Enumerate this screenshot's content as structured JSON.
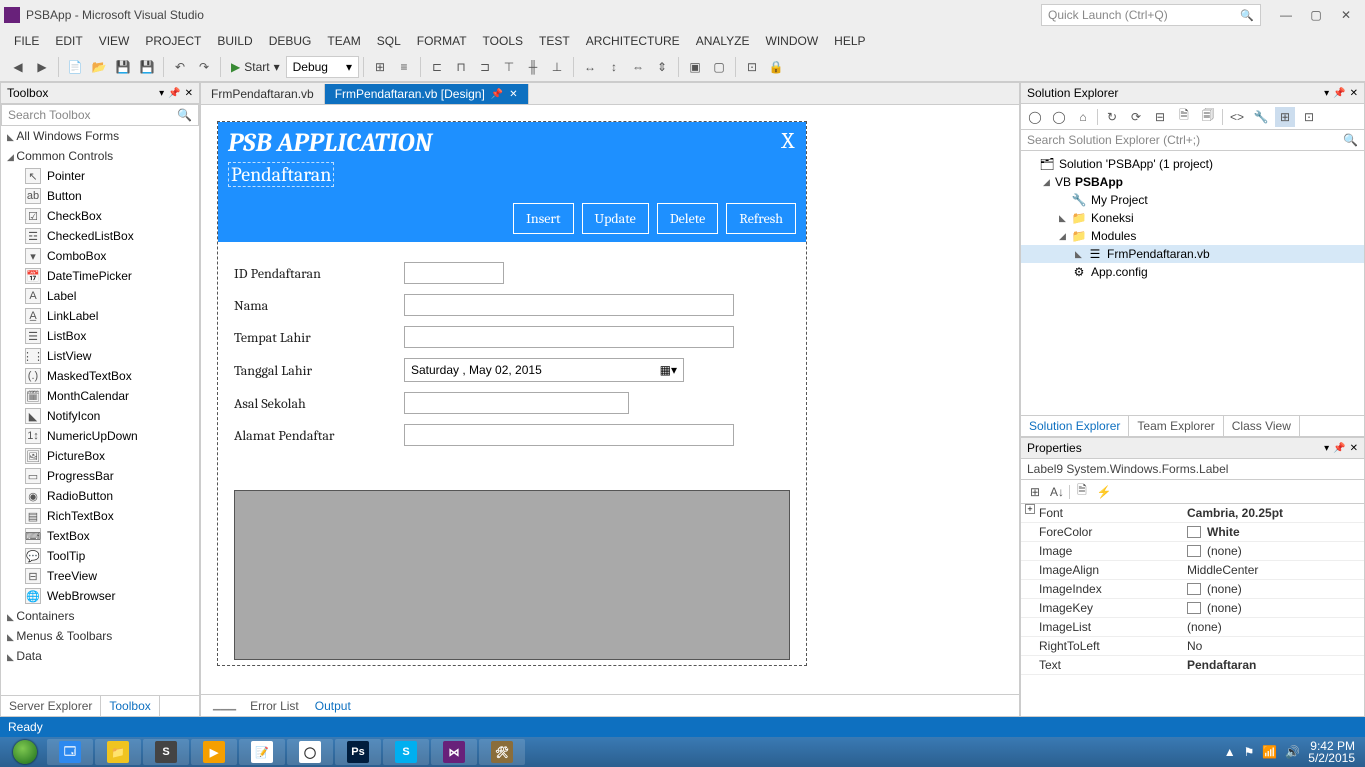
{
  "titlebar": {
    "title": "PSBApp - Microsoft Visual Studio",
    "quick_launch": "Quick Launch (Ctrl+Q)"
  },
  "menu": [
    "FILE",
    "EDIT",
    "VIEW",
    "PROJECT",
    "BUILD",
    "DEBUG",
    "TEAM",
    "SQL",
    "FORMAT",
    "TOOLS",
    "TEST",
    "ARCHITECTURE",
    "ANALYZE",
    "WINDOW",
    "HELP"
  ],
  "toolbar": {
    "start": "Start",
    "config": "Debug"
  },
  "toolbox": {
    "title": "Toolbox",
    "search": "Search Toolbox",
    "cats": [
      {
        "name": "All Windows Forms",
        "open": false
      },
      {
        "name": "Common Controls",
        "open": true,
        "items": [
          {
            "ico": "↖",
            "name": "Pointer"
          },
          {
            "ico": "ab",
            "name": "Button"
          },
          {
            "ico": "☑",
            "name": "CheckBox"
          },
          {
            "ico": "☲",
            "name": "CheckedListBox"
          },
          {
            "ico": "▾",
            "name": "ComboBox"
          },
          {
            "ico": "📅",
            "name": "DateTimePicker"
          },
          {
            "ico": "A",
            "name": "Label"
          },
          {
            "ico": "A̲",
            "name": "LinkLabel"
          },
          {
            "ico": "☰",
            "name": "ListBox"
          },
          {
            "ico": "⋮⋮",
            "name": "ListView"
          },
          {
            "ico": "(.)",
            "name": "MaskedTextBox"
          },
          {
            "ico": "🗓",
            "name": "MonthCalendar"
          },
          {
            "ico": "◣",
            "name": "NotifyIcon"
          },
          {
            "ico": "1↕",
            "name": "NumericUpDown"
          },
          {
            "ico": "🖼",
            "name": "PictureBox"
          },
          {
            "ico": "▭",
            "name": "ProgressBar"
          },
          {
            "ico": "◉",
            "name": "RadioButton"
          },
          {
            "ico": "▤",
            "name": "RichTextBox"
          },
          {
            "ico": "⌨",
            "name": "TextBox"
          },
          {
            "ico": "💬",
            "name": "ToolTip"
          },
          {
            "ico": "⊟",
            "name": "TreeView"
          },
          {
            "ico": "🌐",
            "name": "WebBrowser"
          }
        ]
      },
      {
        "name": "Containers",
        "open": false
      },
      {
        "name": "Menus & Toolbars",
        "open": false
      },
      {
        "name": "Data",
        "open": false
      }
    ],
    "bottom_tabs": [
      "Server Explorer",
      "Toolbox"
    ]
  },
  "editor": {
    "tabs": [
      {
        "label": "FrmPendaftaran.vb",
        "active": false
      },
      {
        "label": "FrmPendaftaran.vb [Design]",
        "active": true
      }
    ],
    "form": {
      "title": "PSB APPLICATION",
      "subtitle": "Pendaftaran",
      "close": "X",
      "buttons": [
        "Insert",
        "Update",
        "Delete",
        "Refresh"
      ],
      "fields": [
        {
          "label": "ID Pendaftaran",
          "w": "w1"
        },
        {
          "label": "Nama",
          "w": "w2"
        },
        {
          "label": "Tempat Lahir",
          "w": "w2"
        }
      ],
      "date_label": "Tanggal Lahir",
      "date_value": "Saturday ,      May      02, 2015",
      "fields2": [
        {
          "label": "Asal Sekolah",
          "w": "w3"
        },
        {
          "label": "Alamat Pendaftar",
          "w": "w2"
        }
      ]
    },
    "out_label": "Output",
    "out_tabs": [
      "Error List",
      "Output"
    ]
  },
  "solexp": {
    "title": "Solution Explorer",
    "search": "Search Solution Explorer (Ctrl+;)",
    "nodes": [
      {
        "d": 0,
        "arr": "",
        "ico": "🗂",
        "label": "Solution 'PSBApp' (1 project)"
      },
      {
        "d": 1,
        "arr": "◢",
        "ico": "VB",
        "label": "PSBApp",
        "bold": true
      },
      {
        "d": 2,
        "arr": "",
        "ico": "🔧",
        "label": "My Project"
      },
      {
        "d": 2,
        "arr": "◣",
        "ico": "📁",
        "label": "Koneksi"
      },
      {
        "d": 2,
        "arr": "◢",
        "ico": "📁",
        "label": "Modules"
      },
      {
        "d": 3,
        "arr": "◣",
        "ico": "☰",
        "label": "FrmPendaftaran.vb",
        "sel": true
      },
      {
        "d": 2,
        "arr": "",
        "ico": "⚙",
        "label": "App.config"
      }
    ],
    "bottom_tabs": [
      "Solution Explorer",
      "Team Explorer",
      "Class View"
    ]
  },
  "props": {
    "title": "Properties",
    "object": "Label9 System.Windows.Forms.Label",
    "rows": [
      {
        "k": "Font",
        "v": "Cambria, 20.25pt",
        "bold": true,
        "plus": true
      },
      {
        "k": "ForeColor",
        "v": "White",
        "bold": true,
        "sw": true
      },
      {
        "k": "Image",
        "v": "(none)",
        "sw": true
      },
      {
        "k": "ImageAlign",
        "v": "MiddleCenter"
      },
      {
        "k": "ImageIndex",
        "v": "(none)",
        "sw": true
      },
      {
        "k": "ImageKey",
        "v": "(none)",
        "sw": true
      },
      {
        "k": "ImageList",
        "v": "(none)"
      },
      {
        "k": "RightToLeft",
        "v": "No"
      },
      {
        "k": "Text",
        "v": "Pendaftaran",
        "bold": true
      }
    ]
  },
  "status": "Ready",
  "taskbar": {
    "apps": [
      {
        "bg": "#2d89ef",
        "txt": "🗔"
      },
      {
        "bg": "#f0c420",
        "txt": "📁"
      },
      {
        "bg": "#444",
        "txt": "S"
      },
      {
        "bg": "#f59f00",
        "txt": "▶"
      },
      {
        "bg": "#fff",
        "txt": "📝"
      },
      {
        "bg": "#fff",
        "txt": "◯"
      },
      {
        "bg": "#001d3d",
        "txt": "Ps"
      },
      {
        "bg": "#00aff0",
        "txt": "S"
      },
      {
        "bg": "#68217a",
        "txt": "⋈"
      },
      {
        "bg": "#8a6d3b",
        "txt": "🛠"
      }
    ],
    "time": "9:42 PM",
    "date": "5/2/2015"
  }
}
